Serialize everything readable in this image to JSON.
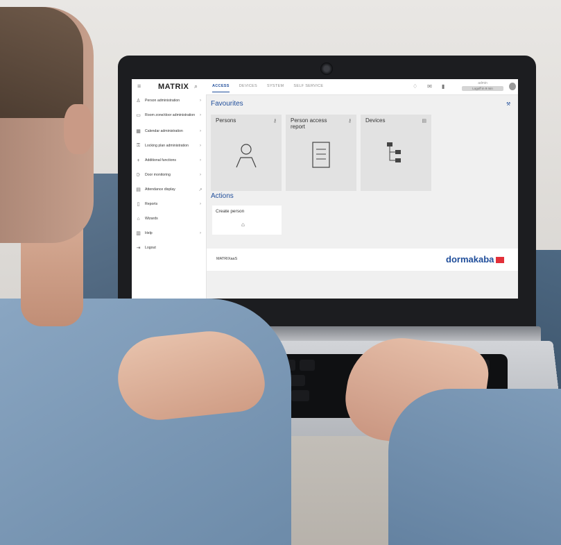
{
  "app": {
    "brand": "MATRIX",
    "tabs": [
      "ACCESS",
      "DEVICES",
      "SYSTEM",
      "SELF SERVICE"
    ],
    "active_tab": "ACCESS",
    "user": "admin",
    "logoff": "Logoff in 9 min"
  },
  "sidebar": {
    "items": [
      {
        "label": "Person administration",
        "icon": "person-icon"
      },
      {
        "label": "Room zone/door administration",
        "icon": "door-icon"
      },
      {
        "label": "Calendar administration",
        "icon": "calendar-icon"
      },
      {
        "label": "Locking plan administration",
        "icon": "key-icon"
      },
      {
        "label": "Additional functions",
        "icon": "plus-icon"
      },
      {
        "label": "Door monitoring",
        "icon": "door-monitor-icon"
      },
      {
        "label": "Attendance display",
        "icon": "attendance-icon"
      },
      {
        "label": "Reports",
        "icon": "report-icon"
      },
      {
        "label": "Wizards",
        "icon": "wizard-icon"
      },
      {
        "label": "Help",
        "icon": "help-icon"
      },
      {
        "label": "Logout",
        "icon": "logout-icon"
      }
    ]
  },
  "main": {
    "favourites_title": "Favourites",
    "favourites": [
      {
        "label": "Persons"
      },
      {
        "label": "Person access report"
      },
      {
        "label": "Devices"
      }
    ],
    "actions_title": "Actions",
    "actions": [
      {
        "label": "Create person"
      }
    ],
    "footer_text": "MATRIXaaS",
    "logo_text": "dormakaba"
  }
}
